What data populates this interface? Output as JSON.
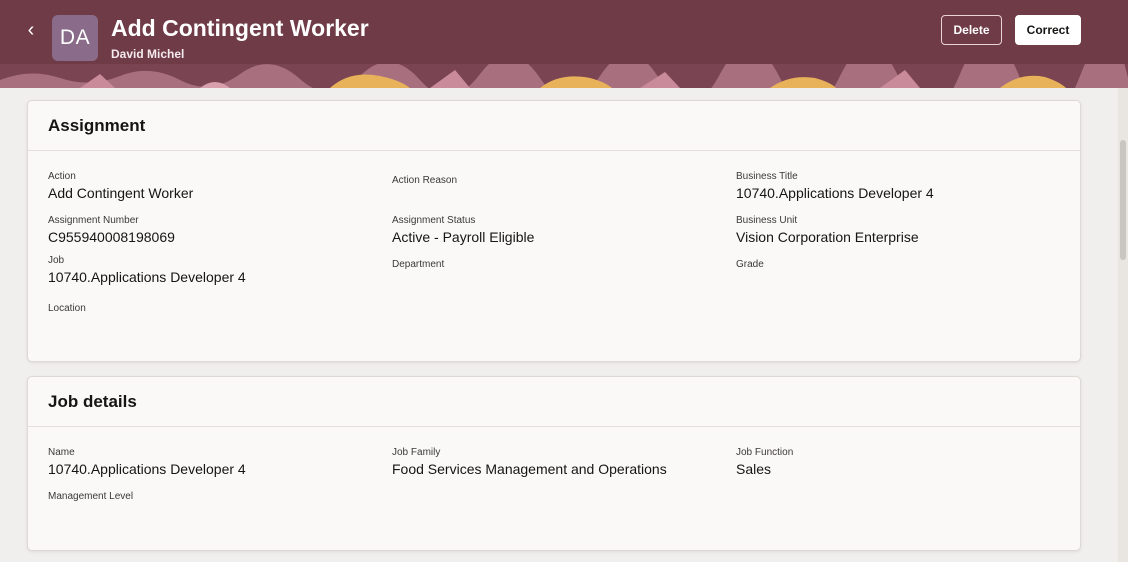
{
  "header": {
    "back_label": "‹",
    "avatar_initials": "DA",
    "title": "Add Contingent Worker",
    "subtitle": "David Michel",
    "delete_label": "Delete",
    "correct_label": "Correct"
  },
  "assignment": {
    "title": "Assignment",
    "fields": [
      {
        "label": "Action",
        "value": "Add Contingent Worker"
      },
      {
        "label": "Action Reason",
        "value": ""
      },
      {
        "label": "Business Title",
        "value": "10740.Applications Developer 4"
      },
      {
        "label": "Assignment Number",
        "value": "C955940008198069"
      },
      {
        "label": "Assignment Status",
        "value": "Active - Payroll Eligible"
      },
      {
        "label": "Business Unit",
        "value": "Vision Corporation Enterprise"
      },
      {
        "label": "Job",
        "value": "10740.Applications Developer 4"
      },
      {
        "label": "Department",
        "value": ""
      },
      {
        "label": "Grade",
        "value": ""
      },
      {
        "label": "Location",
        "value": ""
      }
    ]
  },
  "job_details": {
    "title": "Job details",
    "fields": [
      {
        "label": "Name",
        "value": "10740.Applications Developer 4"
      },
      {
        "label": "Job Family",
        "value": "Food Services Management and Operations"
      },
      {
        "label": "Job Function",
        "value": "Sales"
      },
      {
        "label": "Management Level",
        "value": ""
      }
    ]
  },
  "colors": {
    "header": "#6e3b47",
    "page_background": "#f1efed",
    "card_background": "#fbf9f8"
  }
}
